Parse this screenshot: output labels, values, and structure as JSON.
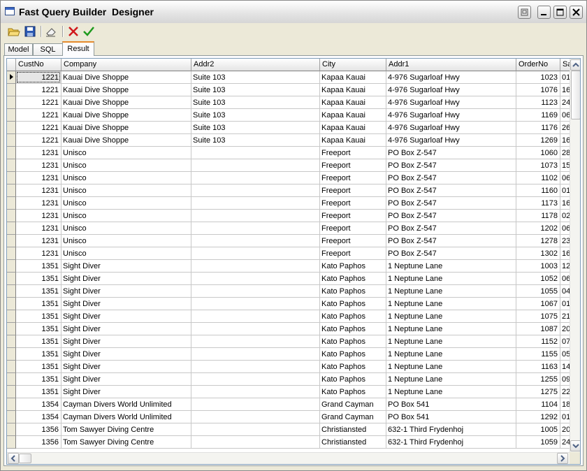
{
  "window": {
    "title": "Fast Query Builder  Designer"
  },
  "toolbar": {
    "buttons": [
      {
        "name": "open-folder-icon"
      },
      {
        "name": "save-disk-icon"
      },
      {
        "name": "eraser-icon"
      },
      {
        "name": "cancel-x-icon"
      },
      {
        "name": "apply-check-icon"
      }
    ]
  },
  "tabs": [
    {
      "label": "Model"
    },
    {
      "label": "SQL"
    },
    {
      "label": "Result",
      "active": true
    }
  ],
  "grid": {
    "columns": [
      "CustNo",
      "Company",
      "Addr2",
      "City",
      "Addr1",
      "OrderNo",
      "Sa"
    ],
    "rows": [
      [
        "1221",
        "Kauai Dive Shoppe",
        "Suite 103",
        "Kapaa Kauai",
        "4-976 Sugarloaf Hwy",
        "1023",
        "01"
      ],
      [
        "1221",
        "Kauai Dive Shoppe",
        "Suite 103",
        "Kapaa Kauai",
        "4-976 Sugarloaf Hwy",
        "1076",
        "16"
      ],
      [
        "1221",
        "Kauai Dive Shoppe",
        "Suite 103",
        "Kapaa Kauai",
        "4-976 Sugarloaf Hwy",
        "1123",
        "24"
      ],
      [
        "1221",
        "Kauai Dive Shoppe",
        "Suite 103",
        "Kapaa Kauai",
        "4-976 Sugarloaf Hwy",
        "1169",
        "06"
      ],
      [
        "1221",
        "Kauai Dive Shoppe",
        "Suite 103",
        "Kapaa Kauai",
        "4-976 Sugarloaf Hwy",
        "1176",
        "26"
      ],
      [
        "1221",
        "Kauai Dive Shoppe",
        "Suite 103",
        "Kapaa Kauai",
        "4-976 Sugarloaf Hwy",
        "1269",
        "16"
      ],
      [
        "1231",
        "Unisco",
        "",
        "Freeport",
        "PO Box Z-547",
        "1060",
        "28"
      ],
      [
        "1231",
        "Unisco",
        "",
        "Freeport",
        "PO Box Z-547",
        "1073",
        "15"
      ],
      [
        "1231",
        "Unisco",
        "",
        "Freeport",
        "PO Box Z-547",
        "1102",
        "06"
      ],
      [
        "1231",
        "Unisco",
        "",
        "Freeport",
        "PO Box Z-547",
        "1160",
        "01"
      ],
      [
        "1231",
        "Unisco",
        "",
        "Freeport",
        "PO Box Z-547",
        "1173",
        "16"
      ],
      [
        "1231",
        "Unisco",
        "",
        "Freeport",
        "PO Box Z-547",
        "1178",
        "02"
      ],
      [
        "1231",
        "Unisco",
        "",
        "Freeport",
        "PO Box Z-547",
        "1202",
        "06"
      ],
      [
        "1231",
        "Unisco",
        "",
        "Freeport",
        "PO Box Z-547",
        "1278",
        "23"
      ],
      [
        "1231",
        "Unisco",
        "",
        "Freeport",
        "PO Box Z-547",
        "1302",
        "16"
      ],
      [
        "1351",
        "Sight Diver",
        "",
        "Kato Paphos",
        "1 Neptune Lane",
        "1003",
        "12"
      ],
      [
        "1351",
        "Sight Diver",
        "",
        "Kato Paphos",
        "1 Neptune Lane",
        "1052",
        "06"
      ],
      [
        "1351",
        "Sight Diver",
        "",
        "Kato Paphos",
        "1 Neptune Lane",
        "1055",
        "04"
      ],
      [
        "1351",
        "Sight Diver",
        "",
        "Kato Paphos",
        "1 Neptune Lane",
        "1067",
        "01"
      ],
      [
        "1351",
        "Sight Diver",
        "",
        "Kato Paphos",
        "1 Neptune Lane",
        "1075",
        "21"
      ],
      [
        "1351",
        "Sight Diver",
        "",
        "Kato Paphos",
        "1 Neptune Lane",
        "1087",
        "20"
      ],
      [
        "1351",
        "Sight Diver",
        "",
        "Kato Paphos",
        "1 Neptune Lane",
        "1152",
        "07"
      ],
      [
        "1351",
        "Sight Diver",
        "",
        "Kato Paphos",
        "1 Neptune Lane",
        "1155",
        "05"
      ],
      [
        "1351",
        "Sight Diver",
        "",
        "Kato Paphos",
        "1 Neptune Lane",
        "1163",
        "14"
      ],
      [
        "1351",
        "Sight Diver",
        "",
        "Kato Paphos",
        "1 Neptune Lane",
        "1255",
        "09"
      ],
      [
        "1351",
        "Sight Diver",
        "",
        "Kato Paphos",
        "1 Neptune Lane",
        "1275",
        "22"
      ],
      [
        "1354",
        "Cayman Divers World Unlimited",
        "",
        "Grand Cayman",
        "PO Box 541",
        "1104",
        "18"
      ],
      [
        "1354",
        "Cayman Divers World Unlimited",
        "",
        "Grand Cayman",
        "PO Box 541",
        "1292",
        "01"
      ],
      [
        "1356",
        "Tom Sawyer Diving Centre",
        "",
        "Christiansted",
        "632-1 Third Frydenhoj",
        "1005",
        "20"
      ],
      [
        "1356",
        "Tom Sawyer Diving Centre",
        "",
        "Christiansted",
        "632-1 Third Frydenhoj",
        "1059",
        "24"
      ]
    ]
  },
  "colors": {
    "active_tab_accent": "#e68b2c",
    "grid_border": "#7f9db9"
  }
}
